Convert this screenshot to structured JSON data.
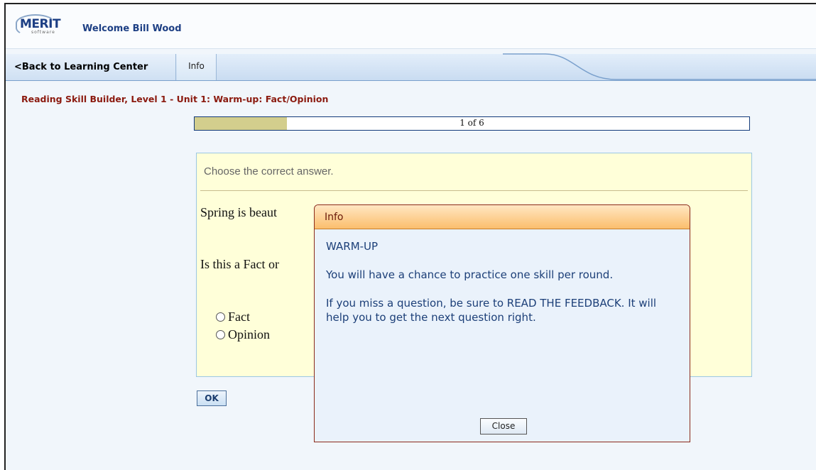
{
  "header": {
    "logo_text": "MERIT",
    "logo_sub": "software",
    "welcome": "Welcome Bill Wood"
  },
  "nav": {
    "back_label": "<Back to Learning Center",
    "info_label": "Info"
  },
  "breadcrumb": "Reading Skill Builder, Level 1 - Unit 1: Warm-up: Fact/Opinion",
  "progress": {
    "text": "1 of 6",
    "current": 1,
    "total": 6
  },
  "question": {
    "instruction": "Choose the correct answer.",
    "statement": "Spring is beaut",
    "prompt": "Is this a Fact or",
    "options": [
      "Fact",
      "Opinion"
    ],
    "ok_label": "OK"
  },
  "dialog": {
    "title": "Info",
    "heading": "WARM-UP",
    "paragraph1": "You will have a chance to practice one skill per round.",
    "paragraph2": "If you miss a question, be sure to READ THE FEEDBACK. It will help you to get the next question right.",
    "close_label": "Close"
  },
  "colors": {
    "breadcrumb": "#8b1a0f",
    "brand_blue": "#1d3f84",
    "question_bg": "#ffffd9",
    "progress_fill": "#d3ce8d",
    "dialog_header": "#fbbe6d"
  }
}
